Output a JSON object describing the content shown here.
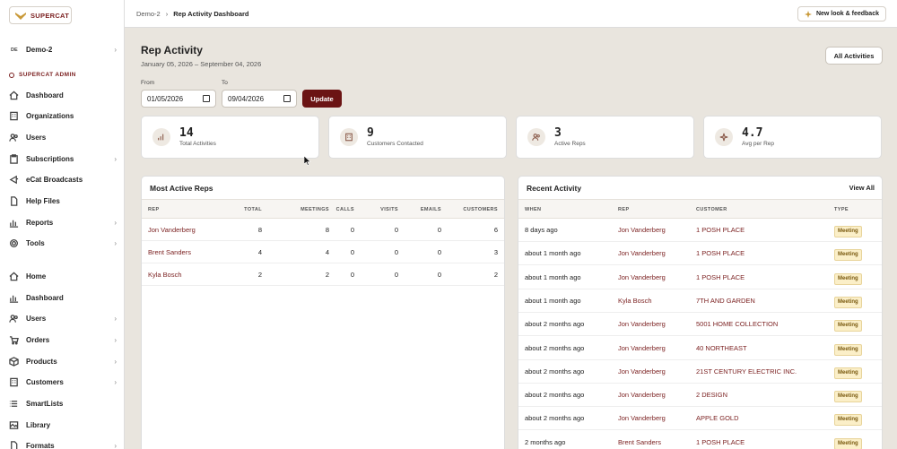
{
  "brand": {
    "name": "SUPERCAT"
  },
  "org": {
    "initials": "DE",
    "name": "Demo-2"
  },
  "admin_section": "SUPERCAT ADMIN",
  "admin_nav": [
    {
      "label": "Dashboard",
      "icon": "home-icon",
      "chev": false
    },
    {
      "label": "Organizations",
      "icon": "building-icon",
      "chev": false
    },
    {
      "label": "Users",
      "icon": "users-icon",
      "chev": false
    },
    {
      "label": "Subscriptions",
      "icon": "clipboard-icon",
      "chev": true
    },
    {
      "label": "eCat Broadcasts",
      "icon": "broadcast-icon",
      "chev": false
    },
    {
      "label": "Help Files",
      "icon": "file-icon",
      "chev": false
    },
    {
      "label": "Reports",
      "icon": "chart-icon",
      "chev": true
    },
    {
      "label": "Tools",
      "icon": "gear-icon",
      "chev": true
    }
  ],
  "main_nav": [
    {
      "label": "Home",
      "icon": "home-icon",
      "chev": false
    },
    {
      "label": "Dashboard",
      "icon": "chart-icon",
      "chev": false
    },
    {
      "label": "Users",
      "icon": "users-icon",
      "chev": true
    },
    {
      "label": "Orders",
      "icon": "cart-icon",
      "chev": true
    },
    {
      "label": "Products",
      "icon": "box-icon",
      "chev": true
    },
    {
      "label": "Customers",
      "icon": "building-icon",
      "chev": true
    },
    {
      "label": "SmartLists",
      "icon": "list-icon",
      "chev": false
    },
    {
      "label": "Library",
      "icon": "image-icon",
      "chev": false
    },
    {
      "label": "Formats",
      "icon": "file-icon",
      "chev": true
    }
  ],
  "breadcrumb": {
    "parent": "Demo-2",
    "sep": "›",
    "current": "Rep Activity Dashboard"
  },
  "new_look": "New look & feedback",
  "page": {
    "title": "Rep Activity",
    "date_range": "January 05, 2026 – September 04, 2026"
  },
  "all_activities": "All Activities",
  "filters": {
    "from_label": "From",
    "from_value": "01/05/2026",
    "to_label": "To",
    "to_value": "09/04/2026",
    "update": "Update"
  },
  "stats": [
    {
      "value": "14",
      "label": "Total Activities",
      "icon": "bar-chart-icon"
    },
    {
      "value": "9",
      "label": "Customers Contacted",
      "icon": "building-icon"
    },
    {
      "value": "3",
      "label": "Active Reps",
      "icon": "users-icon"
    },
    {
      "value": "4.7",
      "label": "Avg per Rep",
      "icon": "sparkle-icon"
    }
  ],
  "most_active": {
    "title": "Most Active Reps",
    "columns": [
      "REP",
      "TOTAL",
      "MEETINGS",
      "CALLS",
      "VISITS",
      "EMAILS",
      "CUSTOMERS"
    ],
    "rows": [
      {
        "rep": "Jon Vanderberg",
        "total": "8",
        "meetings": "8",
        "calls": "0",
        "visits": "0",
        "emails": "0",
        "customers": "6"
      },
      {
        "rep": "Brent Sanders",
        "total": "4",
        "meetings": "4",
        "calls": "0",
        "visits": "0",
        "emails": "0",
        "customers": "3"
      },
      {
        "rep": "Kyla Bosch",
        "total": "2",
        "meetings": "2",
        "calls": "0",
        "visits": "0",
        "emails": "0",
        "customers": "2"
      }
    ]
  },
  "recent": {
    "title": "Recent Activity",
    "view_all": "View All",
    "columns": [
      "WHEN",
      "REP",
      "CUSTOMER",
      "TYPE"
    ],
    "rows": [
      {
        "when": "8 days ago",
        "rep": "Jon Vanderberg",
        "customer": "1 POSH PLACE",
        "type": "Meeting"
      },
      {
        "when": "about 1 month ago",
        "rep": "Jon Vanderberg",
        "customer": "1 POSH PLACE",
        "type": "Meeting"
      },
      {
        "when": "about 1 month ago",
        "rep": "Jon Vanderberg",
        "customer": "1 POSH PLACE",
        "type": "Meeting"
      },
      {
        "when": "about 1 month ago",
        "rep": "Kyla Bosch",
        "customer": "7TH AND GARDEN",
        "type": "Meeting"
      },
      {
        "when": "about 2 months ago",
        "rep": "Jon Vanderberg",
        "customer": "5001 HOME COLLECTION",
        "type": "Meeting"
      },
      {
        "when": "about 2 months ago",
        "rep": "Jon Vanderberg",
        "customer": "40 NORTHEAST",
        "type": "Meeting"
      },
      {
        "when": "about 2 months ago",
        "rep": "Jon Vanderberg",
        "customer": "21ST CENTURY ELECTRIC INC.",
        "type": "Meeting"
      },
      {
        "when": "about 2 months ago",
        "rep": "Jon Vanderberg",
        "customer": "2 DESIGN",
        "type": "Meeting"
      },
      {
        "when": "about 2 months ago",
        "rep": "Jon Vanderberg",
        "customer": "APPLE GOLD",
        "type": "Meeting"
      },
      {
        "when": "2 months ago",
        "rep": "Brent Sanders",
        "customer": "1 POSH PLACE",
        "type": "Meeting"
      }
    ]
  }
}
